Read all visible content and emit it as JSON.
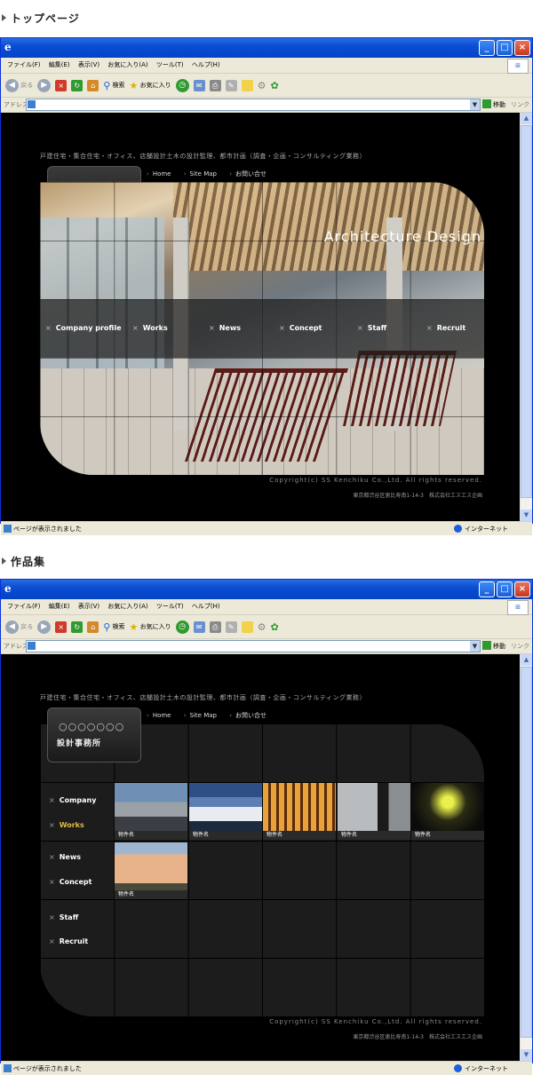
{
  "sections": [
    {
      "title": "トップページ"
    },
    {
      "title": "作品集"
    }
  ],
  "browser": {
    "menu": [
      "ファイル(F)",
      "編集(E)",
      "表示(V)",
      "お気に入り(A)",
      "ツール(T)",
      "ヘルプ(H)"
    ],
    "toolbar": {
      "back": "戻る",
      "search": "検索",
      "favorites": "お気に入り"
    },
    "address_label": "アドレス(D)",
    "go": "移動",
    "links": "リンク",
    "status": "ページが表示されました",
    "zone": "インターネット"
  },
  "site": {
    "tagline": "戸建住宅・集合住宅・オフィス、店舗設計土木の設計監理、都市計画（調査・企画・コンサルティング業務）",
    "logo_dots": "○○○○○○○",
    "logo_name": "設計事務所",
    "topnav": [
      "Home",
      "Site Map",
      "お問い合せ"
    ],
    "hero_title": "Architecture Design",
    "main_nav": [
      "Company profile",
      "Works",
      "News",
      "Concept",
      "Staff",
      "Recruit"
    ],
    "copyright": "Copyright(c) SS Kenchiku Co.,Ltd. All rights reserved.",
    "address": "東京都渋谷区恵比寿南1-14-3　株式会社エスエス企画"
  },
  "works_page": {
    "side_nav": [
      "Company",
      "Works",
      "News",
      "Concept",
      "Staff",
      "Recruit"
    ],
    "active": "Works",
    "items": [
      "物件名",
      "物件名",
      "物件名",
      "物件名",
      "物件名",
      "物件名"
    ]
  }
}
